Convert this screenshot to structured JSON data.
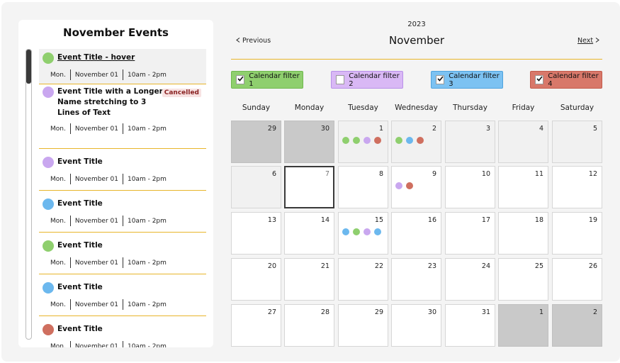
{
  "sidebar": {
    "title": "November Events",
    "events": [
      {
        "title": "Event Title - hover",
        "day": "Mon.",
        "date": "November 01",
        "time": "10am - 2pm",
        "color": "#8fcf6e",
        "badge": ""
      },
      {
        "title": "Event Title with a Longer Name stretching to 3 Lines of Text",
        "day": "Mon.",
        "date": "November 01",
        "time": "10am - 2pm",
        "color": "#c9a7ef",
        "badge": "Cancelled"
      },
      {
        "title": "Event Title",
        "day": "Mon.",
        "date": "November 01",
        "time": "10am - 2pm",
        "color": "#c9a7ef",
        "badge": ""
      },
      {
        "title": "Event Title",
        "day": "Mon.",
        "date": "November 01",
        "time": "10am - 2pm",
        "color": "#6cb8ee",
        "badge": ""
      },
      {
        "title": "Event Title",
        "day": "Mon.",
        "date": "November 01",
        "time": "10am - 2pm",
        "color": "#8fcf6e",
        "badge": ""
      },
      {
        "title": "Event Title",
        "day": "Mon.",
        "date": "November 01",
        "time": "10am - 2pm",
        "color": "#6cb8ee",
        "badge": ""
      },
      {
        "title": "Event Title",
        "day": "Mon.",
        "date": "November 01",
        "time": "10am - 2pm",
        "color": "#cf6f5f",
        "badge": ""
      }
    ]
  },
  "calendar": {
    "year": "2023",
    "month": "November",
    "prev_label": "Previous",
    "next_label": "Next",
    "filters": [
      {
        "label": "Calendar filter 1",
        "checked": true,
        "color": "#8fcf6e",
        "border": "#6fb84e"
      },
      {
        "label": "Calendar filter 2",
        "checked": false,
        "color": "#d9b8f5",
        "border": "#b890e8"
      },
      {
        "label": "Calendar filter 3",
        "checked": true,
        "color": "#7cc2f2",
        "border": "#4fa3dd"
      },
      {
        "label": "Calendar filter 4",
        "checked": true,
        "color": "#d8786a",
        "border": "#c25a4a"
      }
    ],
    "weekdays": [
      "Sunday",
      "Monday",
      "Tuesday",
      "Wednesday",
      "Thursday",
      "Friday",
      "Saturday"
    ],
    "days": [
      {
        "n": "29",
        "type": "other",
        "dots": []
      },
      {
        "n": "30",
        "type": "other",
        "dots": []
      },
      {
        "n": "1",
        "type": "past",
        "dots": [
          "#8fcf6e",
          "#8fcf6e",
          "#c9a7ef",
          "#cf6f5f"
        ]
      },
      {
        "n": "2",
        "type": "past",
        "dots": [
          "#8fcf6e",
          "#6cb8ee",
          "#cf6f5f"
        ]
      },
      {
        "n": "3",
        "type": "past",
        "dots": []
      },
      {
        "n": "4",
        "type": "past",
        "dots": []
      },
      {
        "n": "5",
        "type": "past",
        "dots": []
      },
      {
        "n": "6",
        "type": "past",
        "dots": []
      },
      {
        "n": "7",
        "type": "today",
        "dots": []
      },
      {
        "n": "8",
        "type": "normal",
        "dots": []
      },
      {
        "n": "9",
        "type": "normal",
        "dots": [
          "#c9a7ef",
          "#cf6f5f"
        ]
      },
      {
        "n": "10",
        "type": "normal",
        "dots": []
      },
      {
        "n": "11",
        "type": "normal",
        "dots": []
      },
      {
        "n": "12",
        "type": "normal",
        "dots": []
      },
      {
        "n": "13",
        "type": "normal",
        "dots": []
      },
      {
        "n": "14",
        "type": "normal",
        "dots": []
      },
      {
        "n": "15",
        "type": "normal",
        "dots": [
          "#6cb8ee",
          "#8fcf6e",
          "#c9a7ef",
          "#6cb8ee"
        ]
      },
      {
        "n": "16",
        "type": "normal",
        "dots": []
      },
      {
        "n": "17",
        "type": "normal",
        "dots": []
      },
      {
        "n": "18",
        "type": "normal",
        "dots": []
      },
      {
        "n": "19",
        "type": "normal",
        "dots": []
      },
      {
        "n": "20",
        "type": "normal",
        "dots": []
      },
      {
        "n": "21",
        "type": "normal",
        "dots": []
      },
      {
        "n": "22",
        "type": "normal",
        "dots": []
      },
      {
        "n": "23",
        "type": "normal",
        "dots": []
      },
      {
        "n": "24",
        "type": "normal",
        "dots": []
      },
      {
        "n": "25",
        "type": "normal",
        "dots": []
      },
      {
        "n": "26",
        "type": "normal",
        "dots": []
      },
      {
        "n": "27",
        "type": "normal",
        "dots": []
      },
      {
        "n": "28",
        "type": "normal",
        "dots": []
      },
      {
        "n": "29",
        "type": "normal",
        "dots": []
      },
      {
        "n": "30",
        "type": "normal",
        "dots": []
      },
      {
        "n": "31",
        "type": "normal",
        "dots": []
      },
      {
        "n": "1",
        "type": "other",
        "dots": []
      },
      {
        "n": "2",
        "type": "other",
        "dots": []
      }
    ]
  }
}
